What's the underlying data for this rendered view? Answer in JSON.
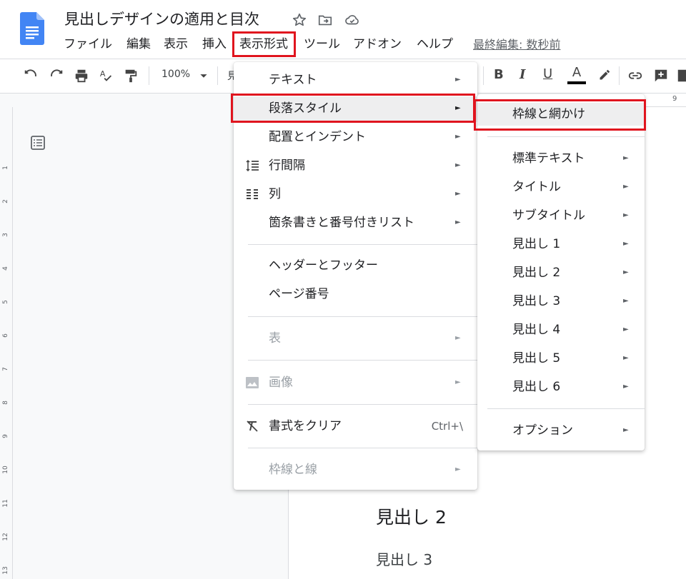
{
  "doc": {
    "title": "見出しデザインの適用と目次",
    "last_edit": "最終編集: 数秒前"
  },
  "menubar": [
    "ファイル",
    "編集",
    "表示",
    "挿入",
    "表示形式",
    "ツール",
    "アドオン",
    "ヘルプ"
  ],
  "toolbar": {
    "zoom": "100%",
    "style_partial": "見"
  },
  "format_menu": {
    "items": [
      {
        "label": "テキスト",
        "arrow": "►"
      },
      {
        "label": "段落スタイル",
        "arrow": "►"
      },
      {
        "label": "配置とインデント",
        "arrow": "►"
      },
      {
        "label": "行間隔",
        "arrow": "►",
        "icon": "line-spacing-icon"
      },
      {
        "label": "列",
        "arrow": "►",
        "icon": "columns-icon"
      },
      {
        "label": "箇条書きと番号付きリスト",
        "arrow": "►"
      },
      {
        "label": "ヘッダーとフッター"
      },
      {
        "label": "ページ番号"
      },
      {
        "label": "表",
        "arrow": "►",
        "disabled": true
      },
      {
        "label": "画像",
        "arrow": "►",
        "disabled": true,
        "icon": "image-icon"
      },
      {
        "label": "書式をクリア",
        "shortcut": "Ctrl+\\",
        "icon": "clear-format-icon"
      },
      {
        "label": "枠線と線",
        "arrow": "►",
        "disabled": true
      }
    ]
  },
  "paragraph_submenu": {
    "items": [
      {
        "label": "枠線と網かけ"
      },
      {
        "label": "標準テキスト",
        "arrow": "►"
      },
      {
        "label": "タイトル",
        "arrow": "►"
      },
      {
        "label": "サブタイトル",
        "arrow": "►"
      },
      {
        "label": "見出し 1",
        "arrow": "►"
      },
      {
        "label": "見出し 2",
        "arrow": "►"
      },
      {
        "label": "見出し 3",
        "arrow": "►"
      },
      {
        "label": "見出し 4",
        "arrow": "►"
      },
      {
        "label": "見出し 5",
        "arrow": "►"
      },
      {
        "label": "見出し 6",
        "arrow": "►"
      },
      {
        "label": "オプション",
        "arrow": "►"
      }
    ]
  },
  "page": {
    "heading2": "見出し 2",
    "heading3": "見出し 3"
  },
  "ruler": {
    "h_tick": "9",
    "v_numbers": [
      "1",
      "2",
      "3",
      "4",
      "5",
      "6",
      "7",
      "8",
      "9",
      "10",
      "11",
      "12",
      "13"
    ]
  },
  "colors": {
    "highlight": "#e0141e",
    "docs_blue": "#4285f4"
  }
}
